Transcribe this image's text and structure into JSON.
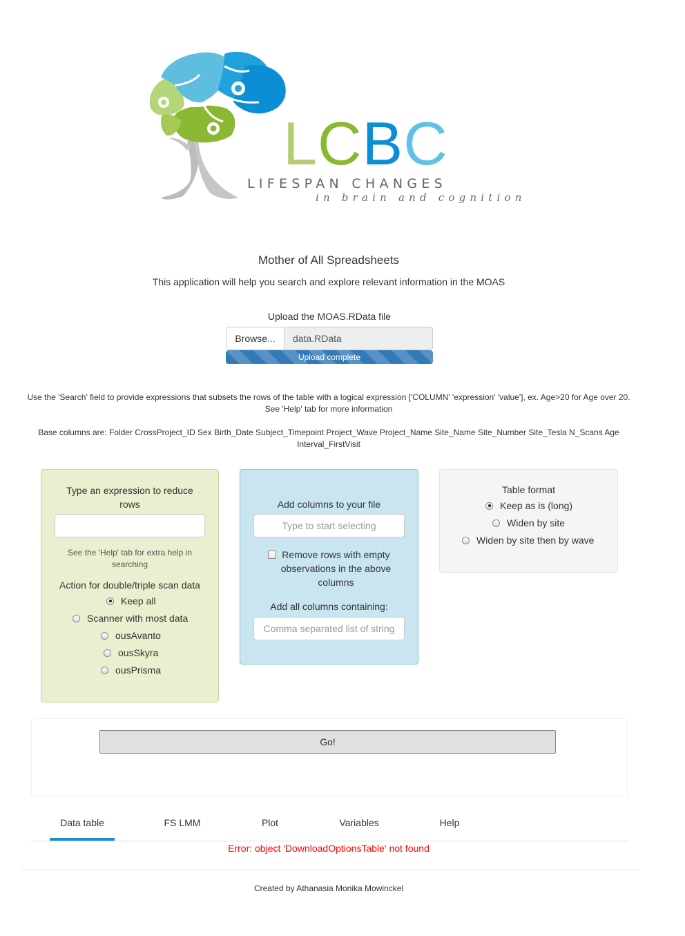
{
  "logo": {
    "letters": [
      {
        "char": "L",
        "color": "#b5cc73"
      },
      {
        "char": "C",
        "color": "#8ab833"
      },
      {
        "char": "B",
        "color": "#0a8fd6"
      },
      {
        "char": "C",
        "color": "#60c1e6"
      }
    ],
    "line1": "LIFESPAN CHANGES",
    "line2": "in brain and cognition"
  },
  "header": {
    "title": "Mother of All Spreadsheets",
    "subtitle": "This application will help you search and explore relevant information in the MOAS"
  },
  "upload": {
    "label": "Upload the MOAS.RData file",
    "browse_label": "Browse...",
    "file_name": "data.RData",
    "progress_text": "Upload complete",
    "progress_fraction": 1.0
  },
  "help": {
    "search_line1": "Use the 'Search' field to provide expressions that subsets the rows of the table with a logical expression ['COLUMN' 'expression' 'value'], ex. Age>20 for Age over 20.",
    "search_line2": "See 'Help' tab for more information",
    "base_columns_line1": "Base columns are: Folder CrossProject_ID Sex Birth_Date Subject_Timepoint Project_Wave Project_Name Site_Name Site_Number Site_Tesla N_Scans Age",
    "base_columns_line2": "Interval_FirstVisit"
  },
  "filter_panel": {
    "expression_label_line1": "Type an expression to reduce",
    "expression_label_line2": "rows",
    "expression_value": "",
    "help_line1": "See the 'Help' tab for extra help in",
    "help_line2": "searching",
    "action_label": "Action for double/triple scan data",
    "options": [
      {
        "label": "Keep all",
        "checked": true
      },
      {
        "label": "Scanner with most data",
        "checked": false
      },
      {
        "label": "ousAvanto",
        "checked": false
      },
      {
        "label": "ousSkyra",
        "checked": false
      },
      {
        "label": "ousPrisma",
        "checked": false
      }
    ]
  },
  "columns_panel": {
    "label": "Add columns to your file",
    "select_placeholder": "Type to start selecting",
    "remove_empty_line1": "Remove rows with empty",
    "remove_empty_line2": "observations in the above",
    "remove_empty_line3": "columns",
    "remove_empty_checked": false,
    "containing_label": "Add all columns containing:",
    "containing_placeholder": "Comma separated list of string"
  },
  "format_panel": {
    "label": "Table format",
    "options": [
      {
        "label": "Keep as is (long)",
        "checked": true
      },
      {
        "label": "Widen by site",
        "checked": false
      },
      {
        "label": "Widen by site then by wave",
        "checked": false
      }
    ]
  },
  "go_label": "Go!",
  "tabs": [
    "Data table",
    "FS LMM",
    "Plot",
    "Variables",
    "Help"
  ],
  "active_tab": "Data table",
  "error_text": "Error: object 'DownloadOptionsTable' not found",
  "footer_text": "Created by Athanasia Monika Mowinckel",
  "colors": {
    "accent": "#1a8ed1",
    "green_panel": "#e8f0cf",
    "blue_panel": "#c9e5ef",
    "gray_panel": "#f5f5f5",
    "error": "#ff0000",
    "progress": "#337ab7"
  }
}
